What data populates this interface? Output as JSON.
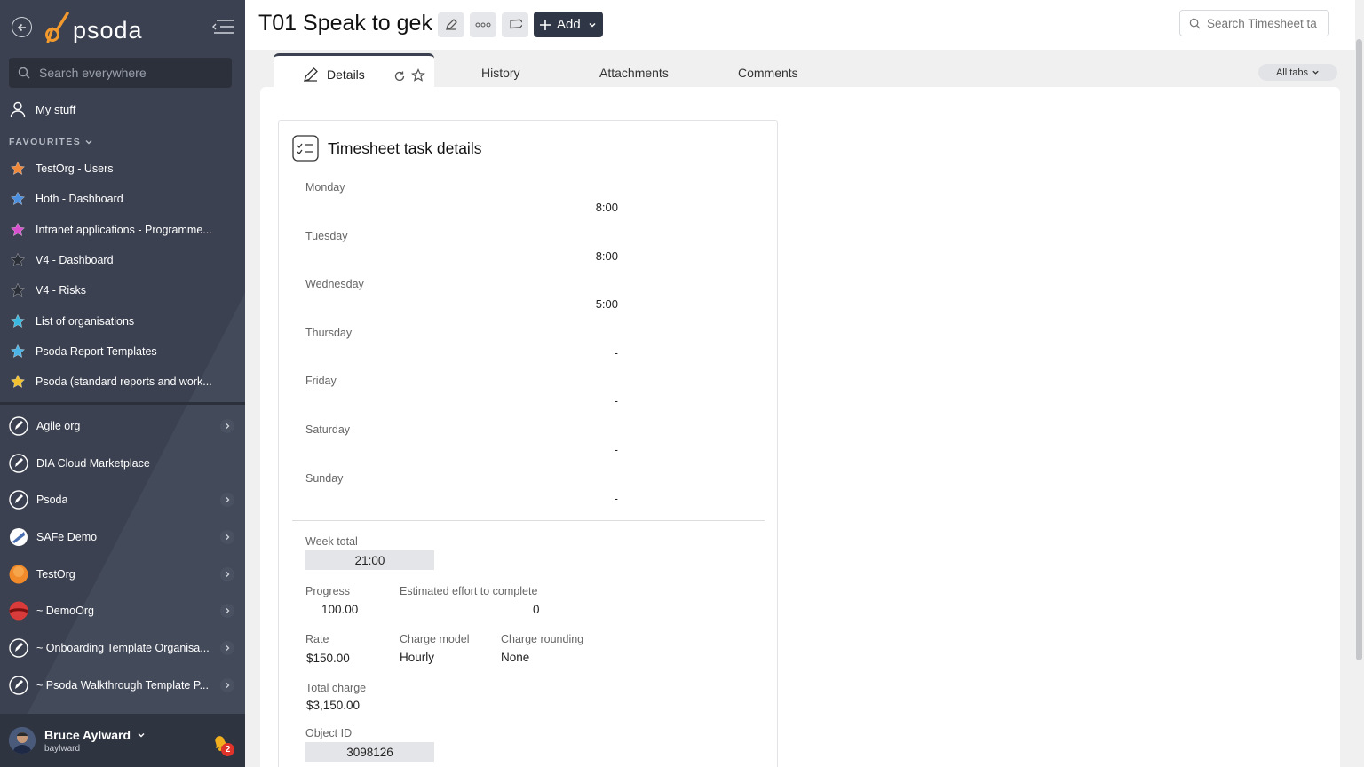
{
  "sidebar": {
    "logo": "psoda",
    "search_placeholder": "Search everywhere",
    "mystuff": "My stuff",
    "favourites_title": "FAVOURITES",
    "favourites": [
      {
        "label": "TestOrg - Users",
        "color": "#f0883a"
      },
      {
        "label": "Hoth - Dashboard",
        "color": "#4b8fe0"
      },
      {
        "label": "Intranet applications - Programme...",
        "color": "#d94fd0"
      },
      {
        "label": "V4 - Dashboard",
        "color": "#2b2f38"
      },
      {
        "label": "V4 - Risks",
        "color": "#2b2f38"
      },
      {
        "label": "List of organisations",
        "color": "#3bb8e0"
      },
      {
        "label": "Psoda Report Templates",
        "color": "#4bb3e6"
      },
      {
        "label": "Psoda (standard reports and work...",
        "color": "#f2c230"
      }
    ],
    "orgs": [
      {
        "label": "Agile org",
        "icon": "rocket-icon"
      },
      {
        "label": "DIA Cloud Marketplace",
        "icon": "rocket-icon"
      },
      {
        "label": "Psoda",
        "icon": "rocket-icon"
      },
      {
        "label": "SAFe Demo",
        "icon": "safe-icon"
      },
      {
        "label": "TestOrg",
        "icon": "orange-circle-icon"
      },
      {
        "label": "~ DemoOrg",
        "icon": "red-circle-icon"
      },
      {
        "label": "~ Onboarding Template Organisa...",
        "icon": "rocket-icon"
      },
      {
        "label": "~ Psoda Walkthrough Template P...",
        "icon": "rocket-icon"
      }
    ],
    "user": {
      "name": "Bruce Aylward",
      "handle": "baylward",
      "notifications": "2"
    }
  },
  "header": {
    "title": "T01 Speak to gek",
    "add_label": "Add",
    "search_placeholder": "Search Timesheet ta"
  },
  "tabs": {
    "details": "Details",
    "history": "History",
    "attachments": "Attachments",
    "comments": "Comments",
    "all_tabs": "All tabs"
  },
  "card": {
    "title": "Timesheet task details",
    "days": [
      {
        "label": "Monday",
        "value": "8:00"
      },
      {
        "label": "Tuesday",
        "value": "8:00"
      },
      {
        "label": "Wednesday",
        "value": "5:00"
      },
      {
        "label": "Thursday",
        "value": "-"
      },
      {
        "label": "Friday",
        "value": "-"
      },
      {
        "label": "Saturday",
        "value": "-"
      },
      {
        "label": "Sunday",
        "value": "-"
      }
    ],
    "week_total_label": "Week total",
    "week_total": "21:00",
    "progress_label": "Progress",
    "progress": "100.00",
    "effort_label": "Estimated effort to complete",
    "effort": "0",
    "rate_label": "Rate",
    "rate": "$150.00",
    "charge_model_label": "Charge model",
    "charge_model": "Hourly",
    "charge_rounding_label": "Charge rounding",
    "charge_rounding": "None",
    "total_charge_label": "Total charge",
    "total_charge": "$3,150.00",
    "object_id_label": "Object ID",
    "object_id": "3098126"
  }
}
